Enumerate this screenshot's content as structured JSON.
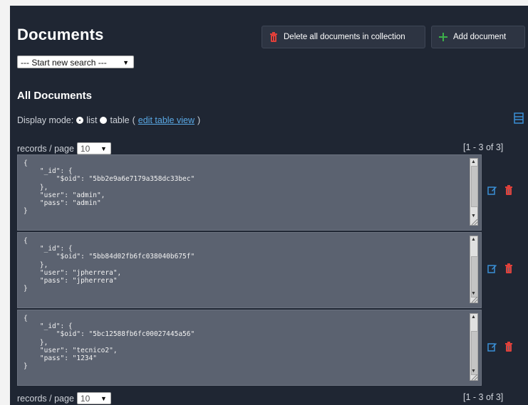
{
  "header": {
    "title": "Documents",
    "delete_all_label": "Delete all documents in collection",
    "add_document_label": "Add document"
  },
  "search": {
    "selected": "--- Start new search ---"
  },
  "section": {
    "title": "All Documents"
  },
  "display_mode": {
    "label": "Display mode:",
    "list_label": "list",
    "table_label": "table",
    "edit_link": "edit table view",
    "open_paren": "(",
    "close_paren": ")",
    "selected": "list"
  },
  "pagination": {
    "records_label": "records / page",
    "per_page": "10",
    "range": "[1 - 3 of 3]"
  },
  "documents": [
    {
      "text": "{\n    \"_id\": {\n        \"$oid\": \"5bb2e9a6e7179a358dc33bec\"\n    },\n    \"user\": \"admin\",\n    \"pass\": \"admin\"\n}"
    },
    {
      "text": "{\n    \"_id\": {\n        \"$oid\": \"5bb84d02fb6fc038040b675f\"\n    },\n    \"user\": \"jpherrera\",\n    \"pass\": \"jpherrera\"\n}"
    },
    {
      "text": "{\n    \"_id\": {\n        \"$oid\": \"5bc12588fb6fc00027445a56\"\n    },\n    \"user\": \"tecnico2\",\n    \"pass\": \"1234\"\n}"
    }
  ],
  "icons": {
    "delete_all": "trash-icon",
    "add": "plus-icon",
    "row_edit": "edit-icon",
    "row_delete": "trash-icon",
    "layout": "columns-icon"
  },
  "colors": {
    "background": "#1f2633",
    "document_bg": "#5b6270",
    "link": "#5aa9e6",
    "danger": "#e0403a",
    "success": "#3cb04a",
    "edit": "#3a8fd6"
  }
}
